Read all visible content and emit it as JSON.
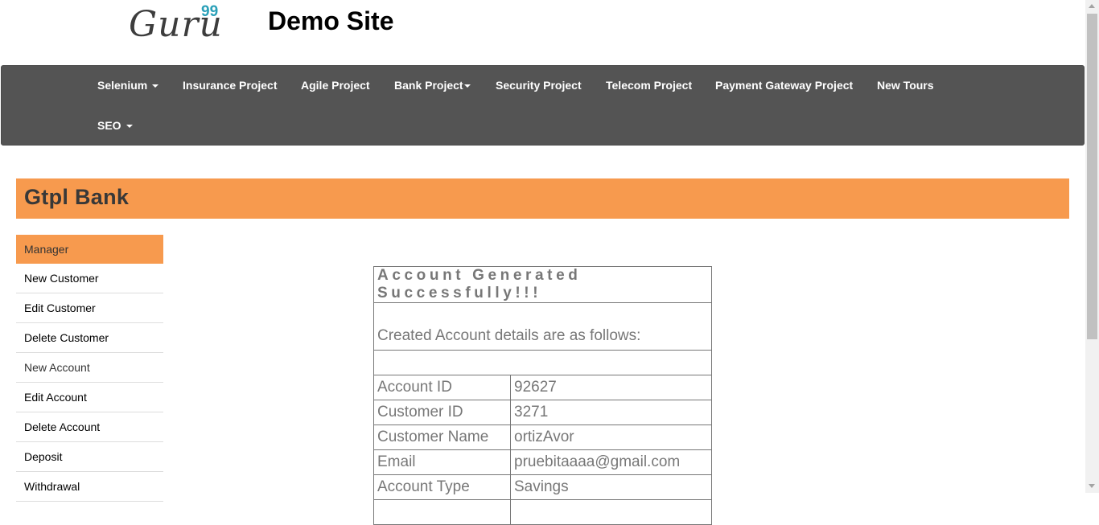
{
  "header": {
    "logo_text": "Guru",
    "logo_superscript": "99",
    "site_title": "Demo Site"
  },
  "navbar": {
    "items": [
      {
        "label": "Selenium",
        "dropdown": true
      },
      {
        "label": "Insurance Project",
        "dropdown": false
      },
      {
        "label": "Agile Project",
        "dropdown": false
      },
      {
        "label": "Bank Project",
        "dropdown": true
      },
      {
        "label": "Security Project",
        "dropdown": false
      },
      {
        "label": "Telecom Project",
        "dropdown": false
      },
      {
        "label": "Payment Gateway Project",
        "dropdown": false
      },
      {
        "label": "New Tours",
        "dropdown": false
      },
      {
        "label": "SEO",
        "dropdown": true
      }
    ]
  },
  "bank": {
    "title": "Gtpl Bank"
  },
  "sidebar": {
    "items": [
      {
        "label": "Manager",
        "active": true
      },
      {
        "label": "New Customer"
      },
      {
        "label": "Edit Customer"
      },
      {
        "label": "Delete Customer"
      },
      {
        "label": "New Account"
      },
      {
        "label": "Edit Account"
      },
      {
        "label": "Delete Account"
      },
      {
        "label": "Deposit"
      },
      {
        "label": "Withdrawal"
      }
    ]
  },
  "account": {
    "success_message": "Account Generated Successfully!!!",
    "details_heading": "Created Account details are as follows:",
    "rows": [
      {
        "label": "Account ID",
        "value": "92627"
      },
      {
        "label": "Customer ID",
        "value": "3271"
      },
      {
        "label": "Customer Name",
        "value": "ortizAvor"
      },
      {
        "label": "Email",
        "value": "pruebitaaaa@gmail.com"
      },
      {
        "label": "Account Type",
        "value": "Savings"
      }
    ]
  },
  "colors": {
    "accent_orange": "#f79a4e",
    "navbar_bg": "#545454",
    "success_green": "#3d7a1a",
    "logo_sup": "#2aa0b8"
  }
}
